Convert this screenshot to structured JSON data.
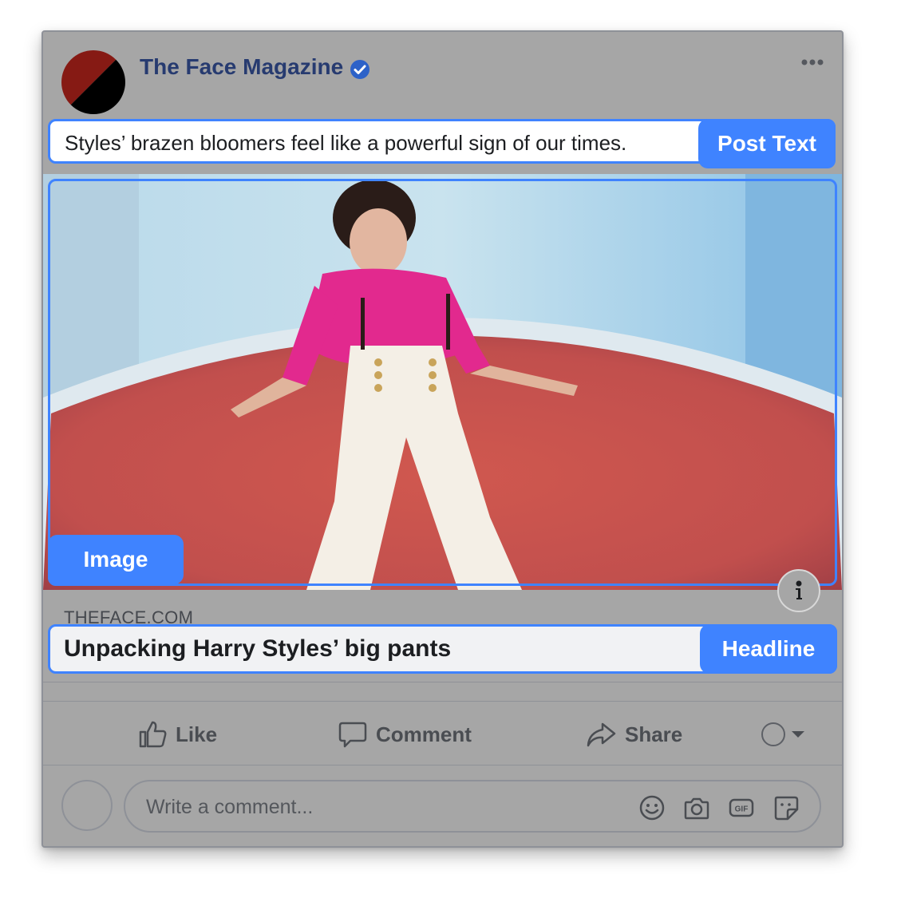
{
  "post": {
    "page_name": "The Face Magazine",
    "text": "Styles’ brazen bloomers feel like a powerful sign of our times.",
    "link_domain": "THEFACE.COM",
    "headline": "Unpacking Harry Styles’ big pants"
  },
  "labels": {
    "post_text": "Post Text",
    "image": "Image",
    "headline": "Headline"
  },
  "actions": {
    "like": "Like",
    "comment": "Comment",
    "share": "Share"
  },
  "comment_box": {
    "placeholder": "Write a comment..."
  },
  "icons": {
    "verified": "verified-badge-icon",
    "more": "more-options-icon",
    "info": "info-icon",
    "like": "thumbs-up-icon",
    "comment": "speech-bubble-icon",
    "share": "share-arrow-icon",
    "emoji": "smiley-icon",
    "camera": "camera-icon",
    "gif": "gif-icon",
    "sticker": "sticker-icon"
  },
  "colors": {
    "accent": "#3f83ff",
    "page_name": "#273b70",
    "card_overlay": "#a6a6a6"
  }
}
